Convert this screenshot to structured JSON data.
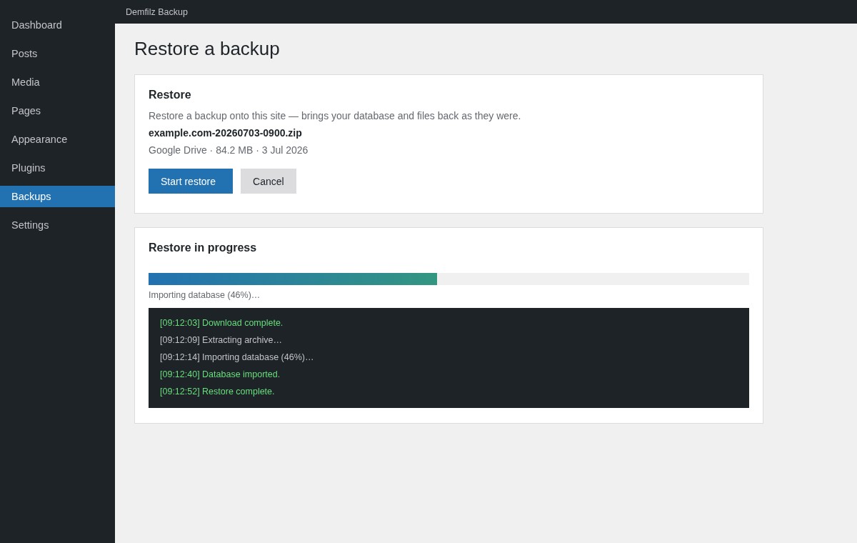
{
  "sidebar": {
    "items": [
      {
        "label": "Dashboard",
        "selected": false
      },
      {
        "label": "Posts",
        "selected": false
      },
      {
        "label": "Media",
        "selected": false
      },
      {
        "label": "Pages",
        "selected": false
      },
      {
        "label": "Appearance",
        "selected": false
      },
      {
        "label": "Plugins",
        "selected": false
      },
      {
        "label": "Backups",
        "selected": true
      },
      {
        "label": "Settings",
        "selected": false
      }
    ]
  },
  "top_bar": {
    "title": "Demfilz Backup"
  },
  "page": {
    "title": "Restore a backup"
  },
  "restore_card": {
    "title": "Restore",
    "description": "Restore a backup onto this site — brings your database and files back as they were.",
    "file_name": "example.com-20260703-0900.zip",
    "file_meta": "Google Drive · 84.2 MB · 3 Jul 2026",
    "buttons": [
      {
        "label": "Start restore",
        "kind": "primary"
      },
      {
        "label": "Cancel",
        "kind": "secondary"
      }
    ]
  },
  "progress_card": {
    "title": "Restore in progress",
    "progress": {
      "level": 0.48,
      "caption": "Importing database (46%)…"
    },
    "log": [
      {
        "text": "[09:12:03] Download complete.",
        "kind": "success"
      },
      {
        "text": "[09:12:09] Extracting archive…",
        "kind": "info"
      },
      {
        "text": "[09:12:14] Importing database (46%)…",
        "kind": "info"
      },
      {
        "text": "[09:12:40] Database imported.",
        "kind": "success"
      },
      {
        "text": "[09:12:52] Restore complete.",
        "kind": "success"
      }
    ]
  }
}
